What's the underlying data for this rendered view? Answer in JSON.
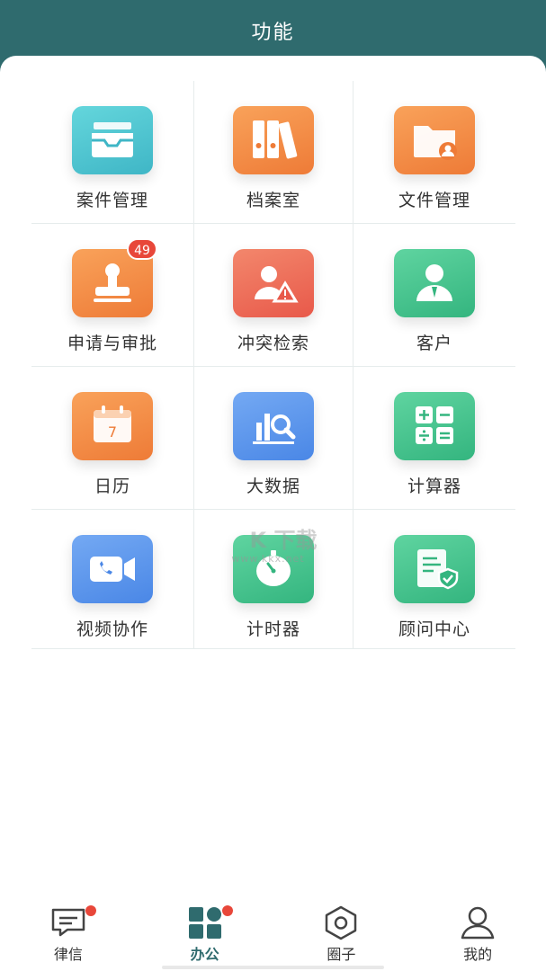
{
  "header": {
    "title": "功能"
  },
  "badges": {
    "approval_count": "49"
  },
  "features": [
    {
      "label": "案件管理",
      "icon": "inbox-tray-icon"
    },
    {
      "label": "档案室",
      "icon": "binders-icon"
    },
    {
      "label": "文件管理",
      "icon": "folder-user-icon"
    },
    {
      "label": "申请与审批",
      "icon": "stamp-icon"
    },
    {
      "label": "冲突检索",
      "icon": "user-warning-icon"
    },
    {
      "label": "客户",
      "icon": "client-person-icon"
    },
    {
      "label": "日历",
      "icon": "calendar-icon"
    },
    {
      "label": "大数据",
      "icon": "chart-magnifier-icon"
    },
    {
      "label": "计算器",
      "icon": "calculator-icon"
    },
    {
      "label": "视频协作",
      "icon": "video-call-icon"
    },
    {
      "label": "计时器",
      "icon": "stopwatch-icon"
    },
    {
      "label": "顾问中心",
      "icon": "shield-document-icon"
    }
  ],
  "calendar_day": "7",
  "watermark": {
    "brand": "K 下载",
    "url": "www.kkx.net"
  },
  "tabbar": {
    "items": [
      {
        "label": "律信",
        "icon": "message-icon"
      },
      {
        "label": "办公",
        "icon": "grid-apps-icon"
      },
      {
        "label": "圈子",
        "icon": "hexagon-circle-icon"
      },
      {
        "label": "我的",
        "icon": "person-icon"
      }
    ],
    "active": "办公"
  },
  "colors": {
    "header": "#2f6b6e",
    "badge": "#e8473a",
    "teal": "#3fb6c6",
    "orange": "#ee7b37",
    "red": "#e8594a",
    "green": "#34b57f",
    "blue": "#4a87e6"
  }
}
